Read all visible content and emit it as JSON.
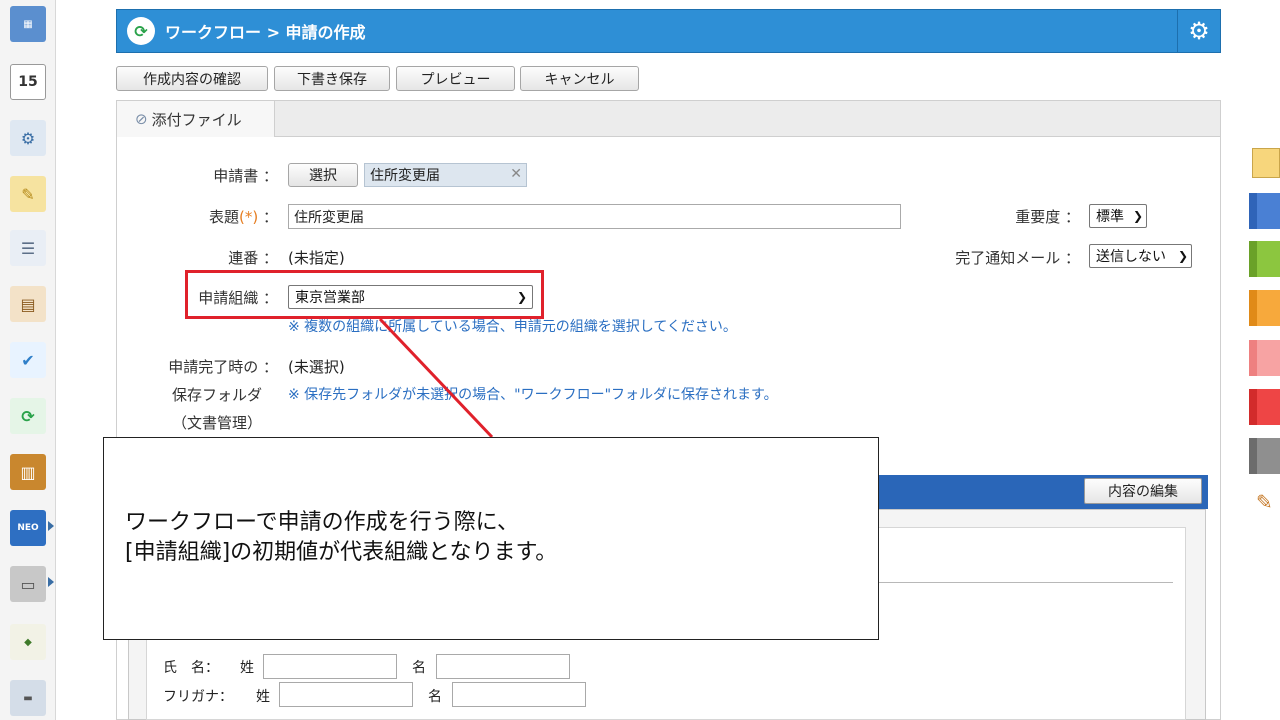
{
  "header": {
    "title": "ワークフロー > 申請の作成"
  },
  "toolbar": {
    "confirm_label": "作成内容の確認",
    "draft_label": "下書き保存",
    "preview_label": "プレビュー",
    "cancel_label": "キャンセル"
  },
  "tabs": {
    "attach_label": "添付ファイル"
  },
  "form": {
    "application_label": "申請書 ：",
    "select_button": "選択",
    "application_value": "住所変更届",
    "title_label_prefix": "表題",
    "title_label_required": "(*)",
    "title_label_suffix": " ：",
    "title_value": "住所変更届",
    "serial_label": "連番 ：",
    "serial_value": "(未指定)",
    "org_label": "申請組織 ：",
    "org_value": "東京営業部",
    "org_note": "※ 複数の組織に所属している場合、申請元の組織を選択してください。",
    "complete_label": "申請完了時の ：",
    "complete_value": "(未選択)",
    "folder_label_1": "保存フォルダ",
    "folder_label_2": "（文書管理）",
    "folder_note": "※ 保存先フォルダが未選択の場合、\"ワークフロー\"フォルダに保存されます。",
    "priority_label": "重要度 ：",
    "priority_value": "標準",
    "notify_label": "完了通知メール ：",
    "notify_value": "送信しない"
  },
  "content": {
    "edit_button": "内容の編集",
    "name_label": "氏　名：",
    "last_name_label": "姓",
    "first_name_label": "名",
    "kana_label": "フリガナ：",
    "kana_last_label": "姓",
    "kana_first_label": "名"
  },
  "callout": {
    "line1": "ワークフローで申請の作成を行う際に、",
    "line2": "[申請組織]の初期値が代表組織となります。"
  },
  "rail": {
    "calendar_day": "15",
    "neo_label": "NEO"
  },
  "colors": {
    "header_blue": "#2e8fd6",
    "highlight_red": "#e0212b",
    "note_blue": "#2b6fc2",
    "content_bar": "#2a66b8"
  }
}
